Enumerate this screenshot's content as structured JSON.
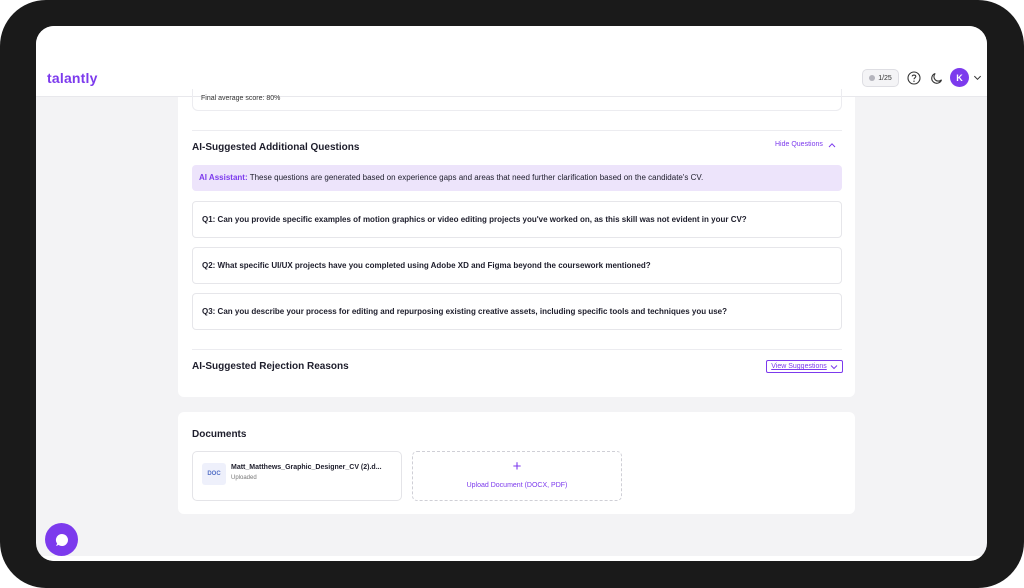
{
  "app": {
    "logo": "talantly"
  },
  "header": {
    "credits": "1/25",
    "avatar_initial": "K",
    "icons": [
      "help-icon",
      "moon-icon",
      "chevron-down-icon"
    ]
  },
  "score": {
    "text": "Final average score: 80%"
  },
  "questions_section": {
    "title": "AI-Suggested Additional Questions",
    "toggle_label": "Hide Questions",
    "assistant_label": "AI Assistant:",
    "assistant_text": " These questions are generated based on experience gaps and areas that need further clarification based on the candidate's CV.",
    "questions": [
      "Q1: Can you provide specific examples of motion graphics or video editing projects you've worked on, as this skill was not evident in your CV?",
      "Q2: What specific UI/UX projects have you completed using Adobe XD and Figma beyond the coursework mentioned?",
      "Q3: Can you describe your process for editing and repurposing existing creative assets, including specific tools and techniques you use?"
    ]
  },
  "rejection_section": {
    "title": "AI-Suggested Rejection Reasons",
    "toggle_label": "View Suggestions"
  },
  "documents": {
    "title": "Documents",
    "items": [
      {
        "badge": "DOC",
        "name": "Matt_Matthews_Graphic_Designer_CV (2).d...",
        "status": "Uploaded"
      }
    ],
    "upload": {
      "plus": "+",
      "label": "Upload Document (DOCX, PDF)"
    }
  },
  "colors": {
    "accent": "#7c3aed",
    "assistant_bg": "#ede4fb",
    "page_bg": "#f3f3f5"
  }
}
